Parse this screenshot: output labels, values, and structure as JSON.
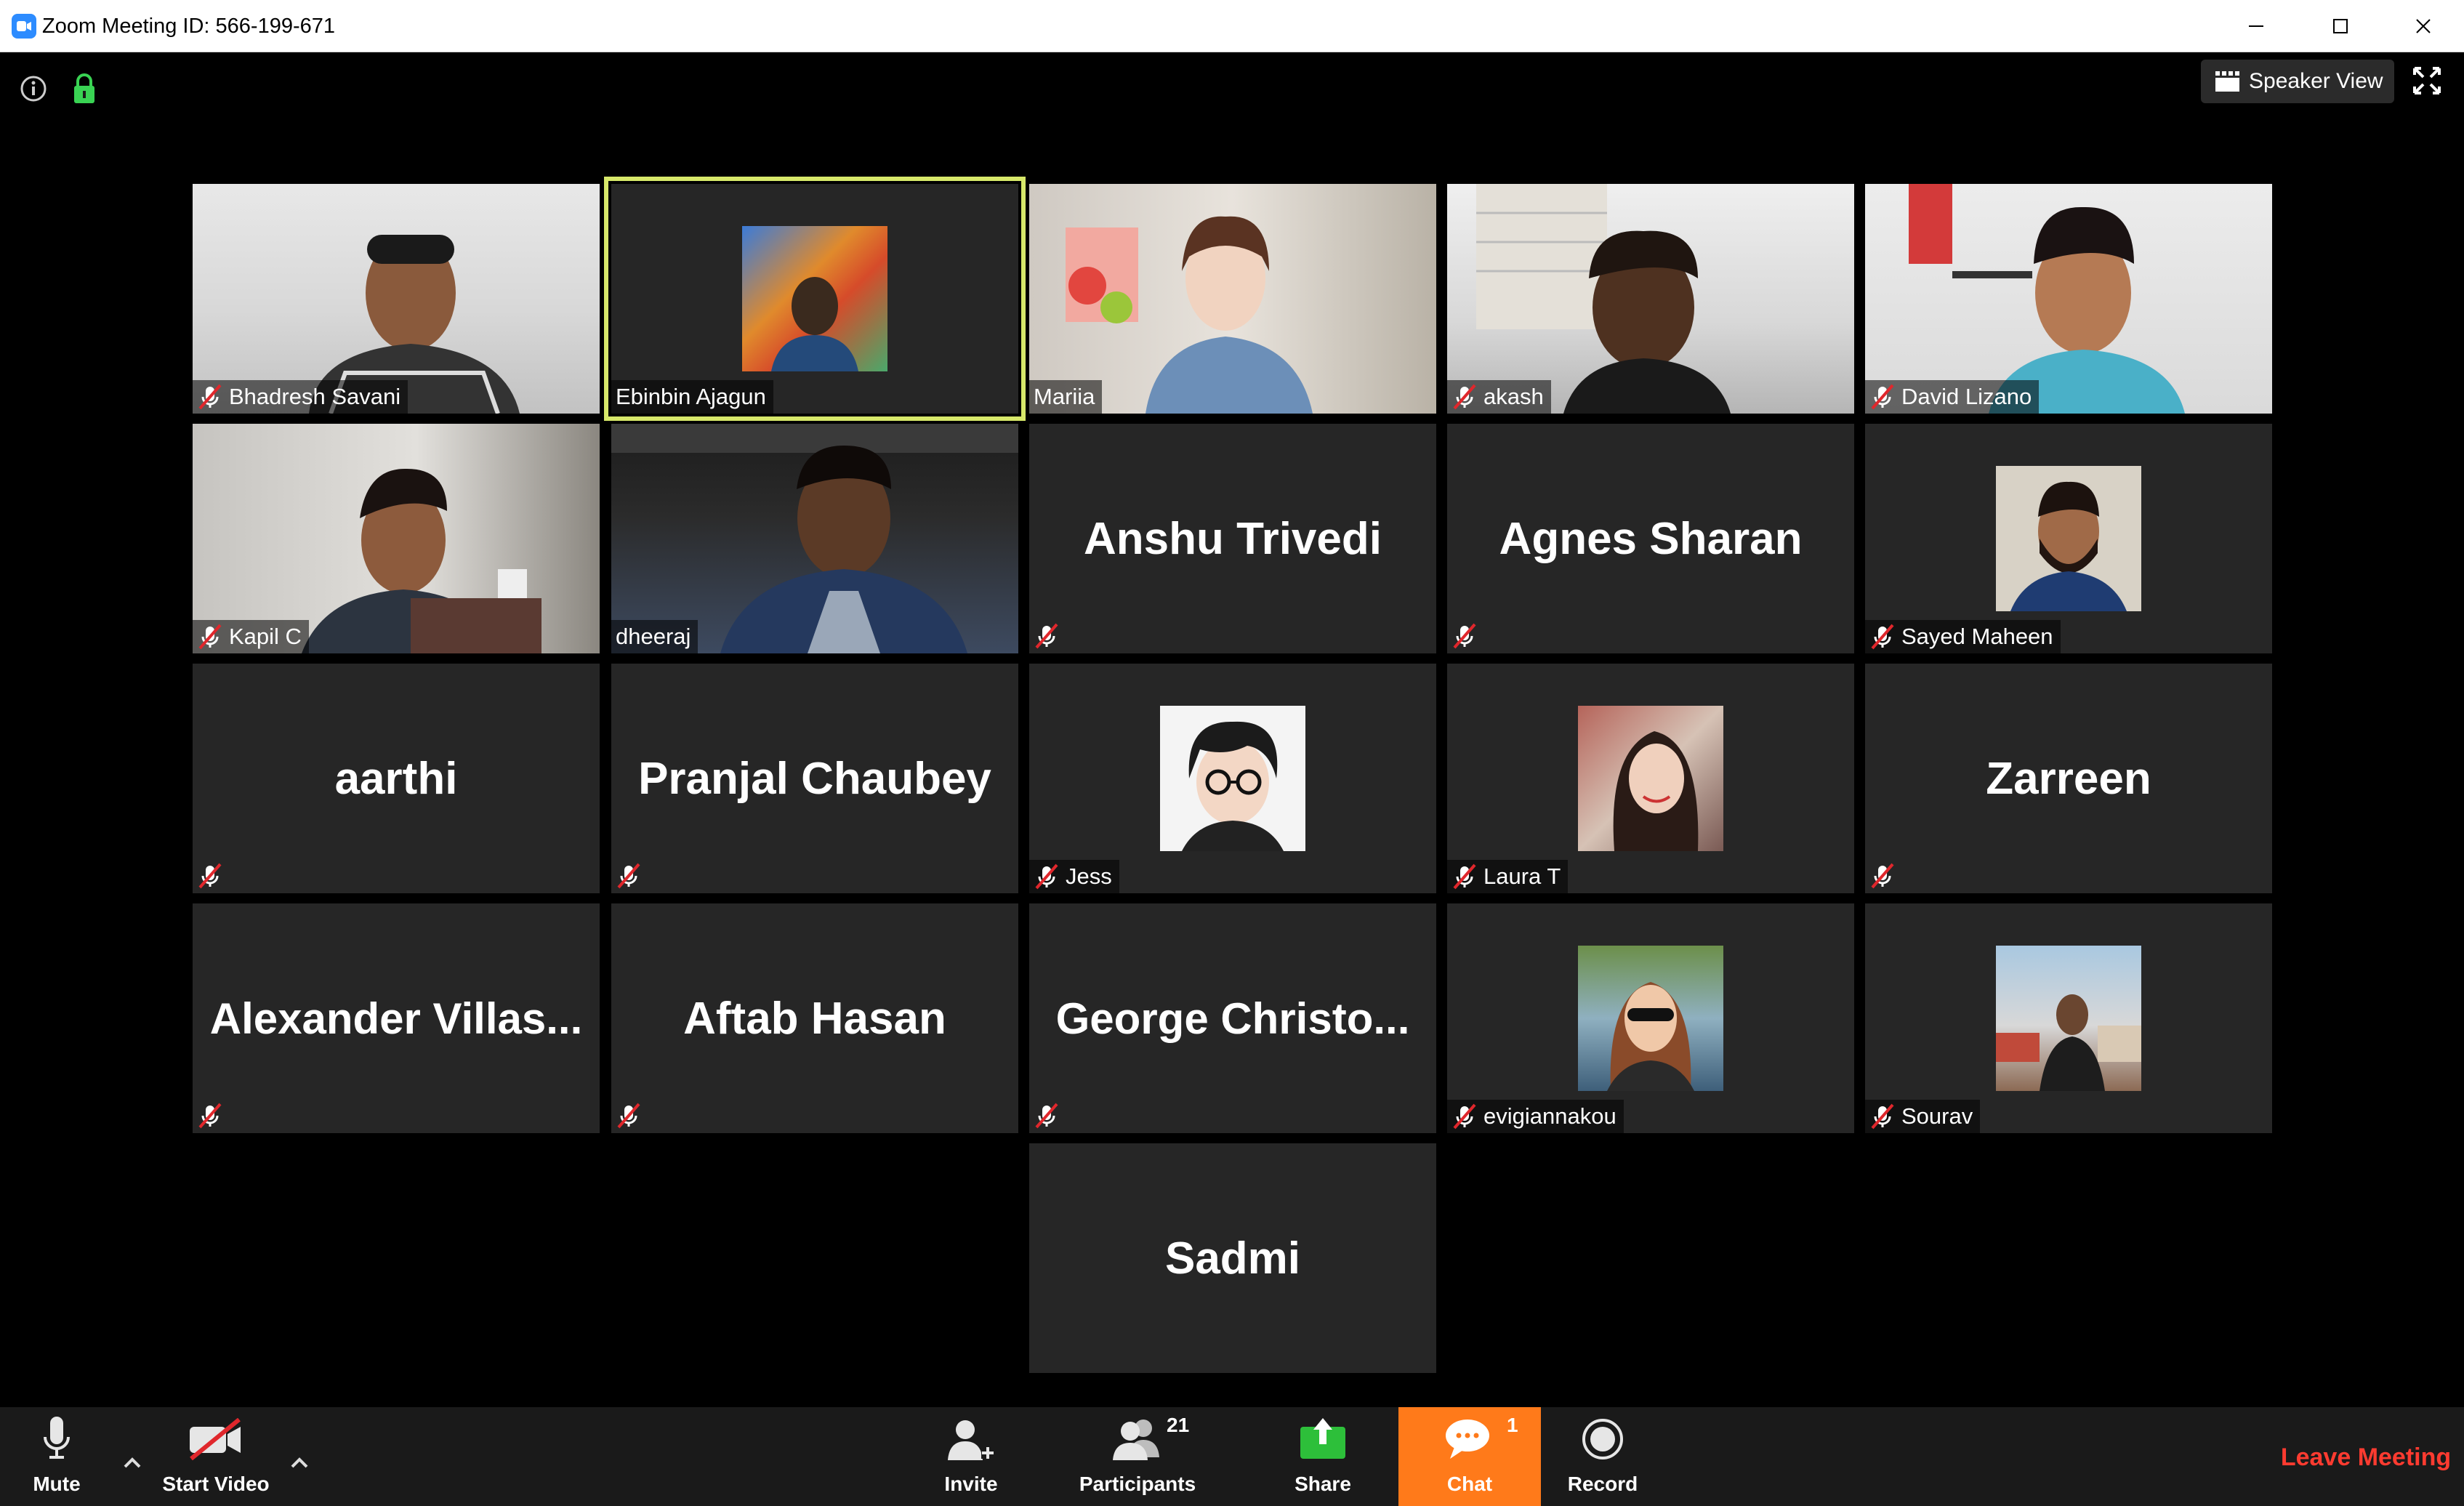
{
  "window": {
    "title": "Zoom Meeting ID: 566-199-671"
  },
  "top_controls": {
    "speaker_view_label": "Speaker View"
  },
  "participants": [
    {
      "name": "Bhadresh Savani",
      "display": "video",
      "muted": true
    },
    {
      "name": "Ebinbin Ajagun",
      "display": "avatar",
      "muted": false,
      "active_speaker": true
    },
    {
      "name": "Mariia",
      "display": "video",
      "muted": false
    },
    {
      "name": "akash",
      "display": "video",
      "muted": true
    },
    {
      "name": "David Lizano",
      "display": "video",
      "muted": true
    },
    {
      "name": "Kapil C",
      "display": "video",
      "muted": true
    },
    {
      "name": "dheeraj",
      "display": "video",
      "muted": false
    },
    {
      "name": "Anshu Trivedi",
      "display": "name",
      "muted": true
    },
    {
      "name": "Agnes Sharan",
      "display": "name",
      "muted": true
    },
    {
      "name": "Sayed Maheen",
      "display": "avatar",
      "muted": true
    },
    {
      "name": "aarthi",
      "display": "name",
      "muted": true
    },
    {
      "name": "Pranjal Chaubey",
      "display": "name",
      "muted": true
    },
    {
      "name": "Jess",
      "display": "avatar",
      "muted": true
    },
    {
      "name": "Laura T",
      "display": "avatar",
      "muted": true
    },
    {
      "name": "Zarreen",
      "display": "name",
      "muted": true
    },
    {
      "name": "Alexander  Villas...",
      "display": "name",
      "muted": true
    },
    {
      "name": "Aftab Hasan",
      "display": "name",
      "muted": true
    },
    {
      "name": "George  Christo...",
      "display": "name",
      "muted": true
    },
    {
      "name": "evigiannakou",
      "display": "avatar",
      "muted": true
    },
    {
      "name": "Sourav",
      "display": "avatar",
      "muted": true
    },
    {
      "name": "Sadmi",
      "display": "name",
      "muted": false
    }
  ],
  "toolbar": {
    "mute_label": "Mute",
    "start_video_label": "Start Video",
    "invite_label": "Invite",
    "participants_label": "Participants",
    "participants_count": "21",
    "share_label": "Share",
    "chat_label": "Chat",
    "chat_unread": "1",
    "record_label": "Record",
    "leave_label": "Leave Meeting"
  },
  "colors": {
    "active_speaker_border": "#d7e86a",
    "chat_active": "#ff7a1a",
    "leave": "#ff3b30",
    "share": "#2dbf3a",
    "brand": "#2d8cff"
  }
}
